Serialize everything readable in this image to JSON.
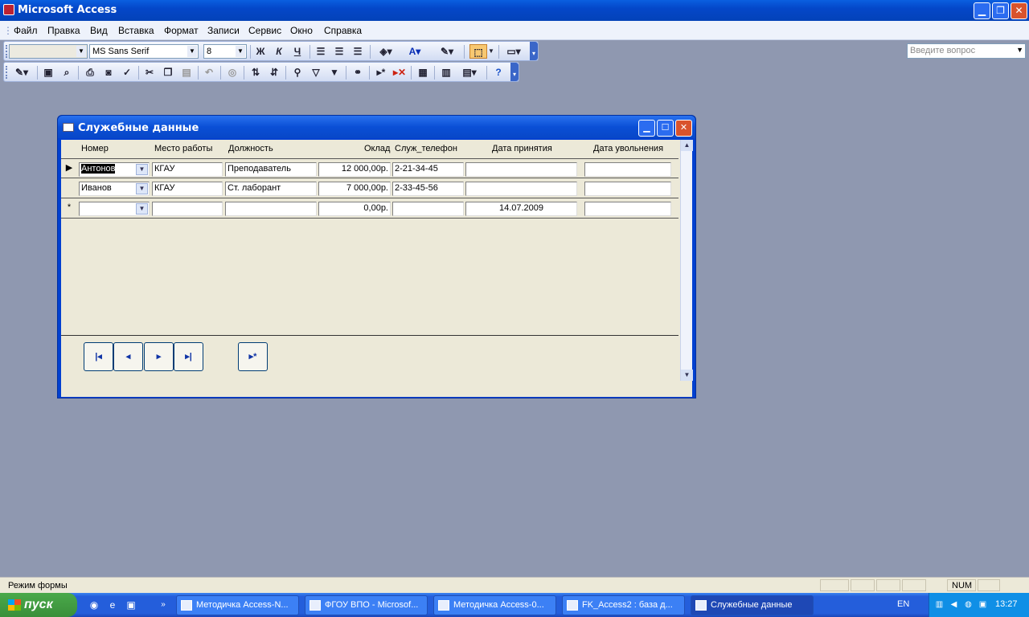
{
  "app": {
    "title": "Microsoft Access"
  },
  "menu": [
    "Файл",
    "Правка",
    "Вид",
    "Вставка",
    "Формат",
    "Записи",
    "Сервис",
    "Окно",
    "Справка"
  ],
  "help": {
    "placeholder": "Введите вопрос"
  },
  "format_toolbar": {
    "font": "MS Sans Serif",
    "size": "8",
    "bold": "Ж",
    "italic": "К",
    "underline": "Ч"
  },
  "form": {
    "title": "Служебные данные",
    "headers": [
      "Номер",
      "Место работы",
      "Должность",
      "Оклад",
      "Служ_телефон",
      "Дата принятия",
      "Дата увольнения"
    ],
    "rows": [
      {
        "selector": "▶",
        "nomer": "Антонов",
        "mesto": "КГАУ",
        "dolzh": "Преподаватель",
        "oklad": "12 000,00р.",
        "tel": "2-21-34-45",
        "date_in": "",
        "date_out": ""
      },
      {
        "selector": "",
        "nomer": "Иванов",
        "mesto": "КГАУ",
        "dolzh": "Ст. лаборант",
        "oklad": "7 000,00р.",
        "tel": "2-33-45-56",
        "date_in": "",
        "date_out": ""
      },
      {
        "selector": "*",
        "nomer": "",
        "mesto": "",
        "dolzh": "",
        "oklad": "0,00р.",
        "tel": "",
        "date_in": "14.07.2009",
        "date_out": ""
      }
    ],
    "nav_buttons": [
      "first-record",
      "previous-record",
      "next-record",
      "last-record",
      "new-record"
    ]
  },
  "status": {
    "text": "Режим формы",
    "num": "NUM"
  },
  "taskbar": {
    "start": "пуск",
    "tasks": [
      "Методичка Access-N...",
      "ФГОУ ВПО - Microsof...",
      "Методичка Access-0...",
      "FK_Access2 : база д...",
      "Служебные данные"
    ],
    "lang": "EN",
    "clock": "13:27"
  }
}
